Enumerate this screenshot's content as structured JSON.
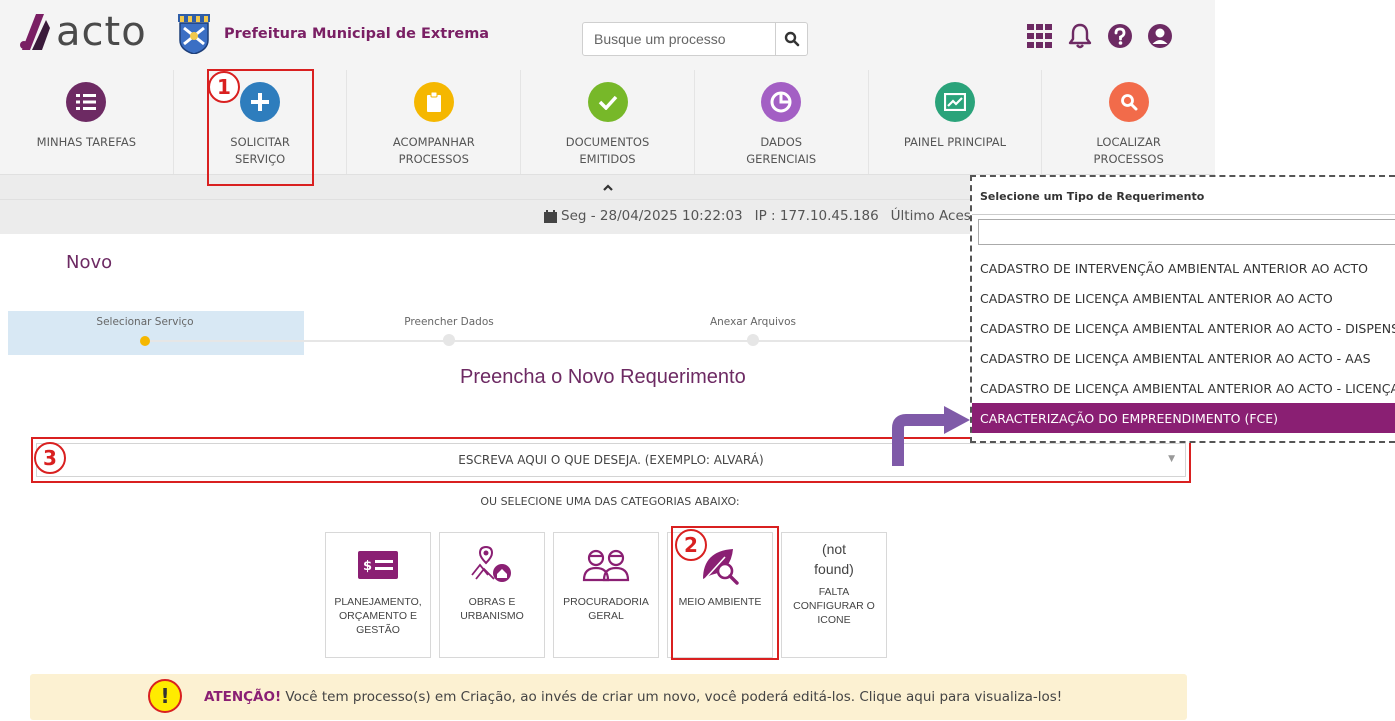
{
  "header": {
    "logo_text": "acto",
    "org_name": "Prefeitura Municipal de Extrema",
    "search_placeholder": "Busque um processo",
    "icons": [
      "apps-grid-icon",
      "bell-icon",
      "help-icon",
      "user-icon"
    ]
  },
  "nav": [
    {
      "label": "MINHAS TAREFAS",
      "color": "#6d2a63",
      "icon": "tasks-list-icon"
    },
    {
      "label": "SOLICITAR SERVIÇO",
      "color": "#2e7dbd",
      "icon": "plus-icon"
    },
    {
      "label": "ACOMPANHAR PROCESSOS",
      "color": "#f5b700",
      "icon": "clipboard-icon"
    },
    {
      "label": "DOCUMENTOS EMITIDOS",
      "color": "#77b829",
      "icon": "check-icon"
    },
    {
      "label": "DADOS GERENCIAIS",
      "color": "#a35fc4",
      "icon": "pie-chart-icon"
    },
    {
      "label": "PAINEL PRINCIPAL",
      "color": "#2aa37a",
      "icon": "line-chart-icon"
    },
    {
      "label": "LOCALIZAR PROCESSOS",
      "color": "#f26b4a",
      "icon": "search-icon"
    }
  ],
  "status": {
    "datetime": "Seg - 28/04/2025 10:22:03",
    "ip": "IP : 177.10.45.186",
    "last_access": "Último Acesso"
  },
  "page": {
    "title": "Novo",
    "subtitle": "Preencha o Novo Requerimento",
    "select_placeholder": "ESCREVA AQUI O QUE DESEJA. (EXEMPLO: ALVARÁ)",
    "or_text": "OU SELECIONE UMA DAS CATEGORIAS ABAIXO:"
  },
  "steps": [
    {
      "label": "Selecionar Serviço",
      "active": true
    },
    {
      "label": "Preencher Dados",
      "active": false
    },
    {
      "label": "Anexar Arquivos",
      "active": false
    }
  ],
  "categories": [
    {
      "label": "PLANEJAMENTO, ORÇAMENTO E GESTÃO",
      "icon": "money-bill-icon"
    },
    {
      "label": "OBRAS E URBANISMO",
      "icon": "city-map-icon"
    },
    {
      "label": "PROCURADORIA GERAL",
      "icon": "lawyers-icon"
    },
    {
      "label": "MEIO AMBIENTE",
      "icon": "leaf-search-icon"
    },
    {
      "label": "FALTA CONFIGURAR O ICONE",
      "notfound": "(not found)"
    }
  ],
  "alert": {
    "icon_text": "!",
    "bold": "ATENÇÃO!",
    "text": " Você tem processo(s) em Criação, ao invés de criar um novo, você poderá editá-los. Clique aqui para visualiza-los!"
  },
  "annotations": {
    "badge1": "1",
    "badge2": "2",
    "badge3": "3"
  },
  "dropdown": {
    "header": "Selecione um Tipo de Requerimento",
    "items": [
      "CADASTRO DE INTERVENÇÃO AMBIENTAL ANTERIOR AO ACTO",
      "CADASTRO DE LICENÇA AMBIENTAL ANTERIOR AO ACTO",
      "CADASTRO DE LICENÇA AMBIENTAL ANTERIOR AO ACTO - DISPENSA",
      "CADASTRO DE LICENÇA AMBIENTAL ANTERIOR AO ACTO - AAS",
      "CADASTRO DE LICENÇA AMBIENTAL ANTERIOR AO ACTO - LICENÇA",
      "CARACTERIZAÇÃO DO EMPREENDIMENTO (FCE)"
    ],
    "selected_index": 5
  }
}
